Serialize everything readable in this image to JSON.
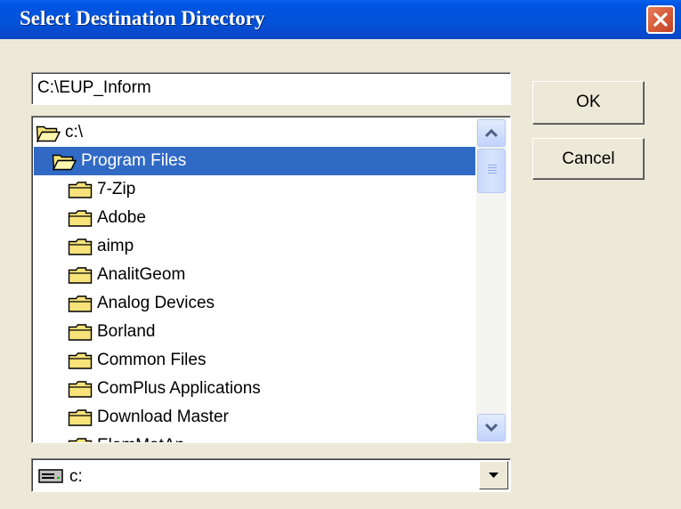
{
  "window": {
    "title": "Select Destination Directory"
  },
  "path_field": {
    "value": "C:\\EUP_Inform"
  },
  "buttons": {
    "ok": "OK",
    "cancel": "Cancel"
  },
  "directory_list": {
    "items": [
      {
        "label": "c:\\",
        "icon": "open-folder-icon",
        "indent": 0,
        "selected": false
      },
      {
        "label": "Program Files",
        "icon": "open-folder-icon",
        "indent": 1,
        "selected": true
      },
      {
        "label": "7-Zip",
        "icon": "folder-icon",
        "indent": 2,
        "selected": false
      },
      {
        "label": "Adobe",
        "icon": "folder-icon",
        "indent": 2,
        "selected": false
      },
      {
        "label": "aimp",
        "icon": "folder-icon",
        "indent": 2,
        "selected": false
      },
      {
        "label": "AnalitGeom",
        "icon": "folder-icon",
        "indent": 2,
        "selected": false
      },
      {
        "label": "Analog Devices",
        "icon": "folder-icon",
        "indent": 2,
        "selected": false
      },
      {
        "label": "Borland",
        "icon": "folder-icon",
        "indent": 2,
        "selected": false
      },
      {
        "label": "Common Files",
        "icon": "folder-icon",
        "indent": 2,
        "selected": false
      },
      {
        "label": "ComPlus Applications",
        "icon": "folder-icon",
        "indent": 2,
        "selected": false
      },
      {
        "label": "Download Master",
        "icon": "folder-icon",
        "indent": 2,
        "selected": false
      },
      {
        "label": "ElemMatAn",
        "icon": "folder-icon",
        "indent": 2,
        "selected": false
      }
    ]
  },
  "drive_select": {
    "value": "c:",
    "icon": "hard-drive-icon"
  },
  "colors": {
    "titlebar": "#0054e3",
    "selection": "#316ac5",
    "dialog_bg": "#ece9d8",
    "folder_yellow": "#f7e37a"
  }
}
